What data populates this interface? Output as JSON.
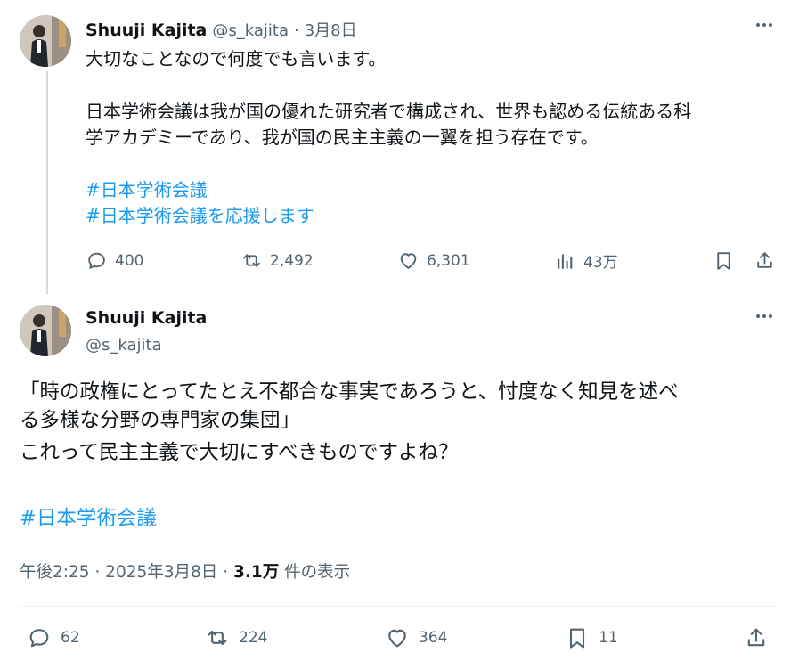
{
  "tweet1": {
    "display_name": "Shuuji Kajita",
    "handle": "@s_kajita",
    "separator": "·",
    "date": "3月8日",
    "lines": [
      "大切なことなので何度でも言います。",
      "日本学術会議は我が国の優れた研究者で構成され、世界も認める伝統ある科",
      "学アカデミーであり、我が国の民主主義の一翼を担う存在です。"
    ],
    "hashtags": [
      "#日本学術会議",
      "#日本学術会議を応援します"
    ],
    "actions": {
      "replies": "400",
      "reposts": "2,492",
      "likes": "6,301",
      "views": "43万"
    },
    "more_icon": "more-horizontal-icon"
  },
  "tweet2": {
    "display_name": "Shuuji Kajita",
    "handle": "@s_kajita",
    "lines": [
      "「時の政権にとってたとえ不都合な事実であろうと、忖度なく知見を述べ",
      "る多様な分野の専門家の集団」",
      "これって民主主義で大切にすべきものですよね？"
    ],
    "hashtag": "#日本学術会議",
    "timestamp": "午後2:25 · 2025年3月8日 ·",
    "view_count": "3.1万",
    "view_label": "件の表示",
    "actions": {
      "replies": "62",
      "reposts": "224",
      "likes": "364",
      "bookmarks": "11"
    }
  },
  "colors": {
    "text": "#0f1419",
    "secondary": "#536471",
    "link": "#1d9bf0",
    "thread_line": "#cfd9de"
  }
}
